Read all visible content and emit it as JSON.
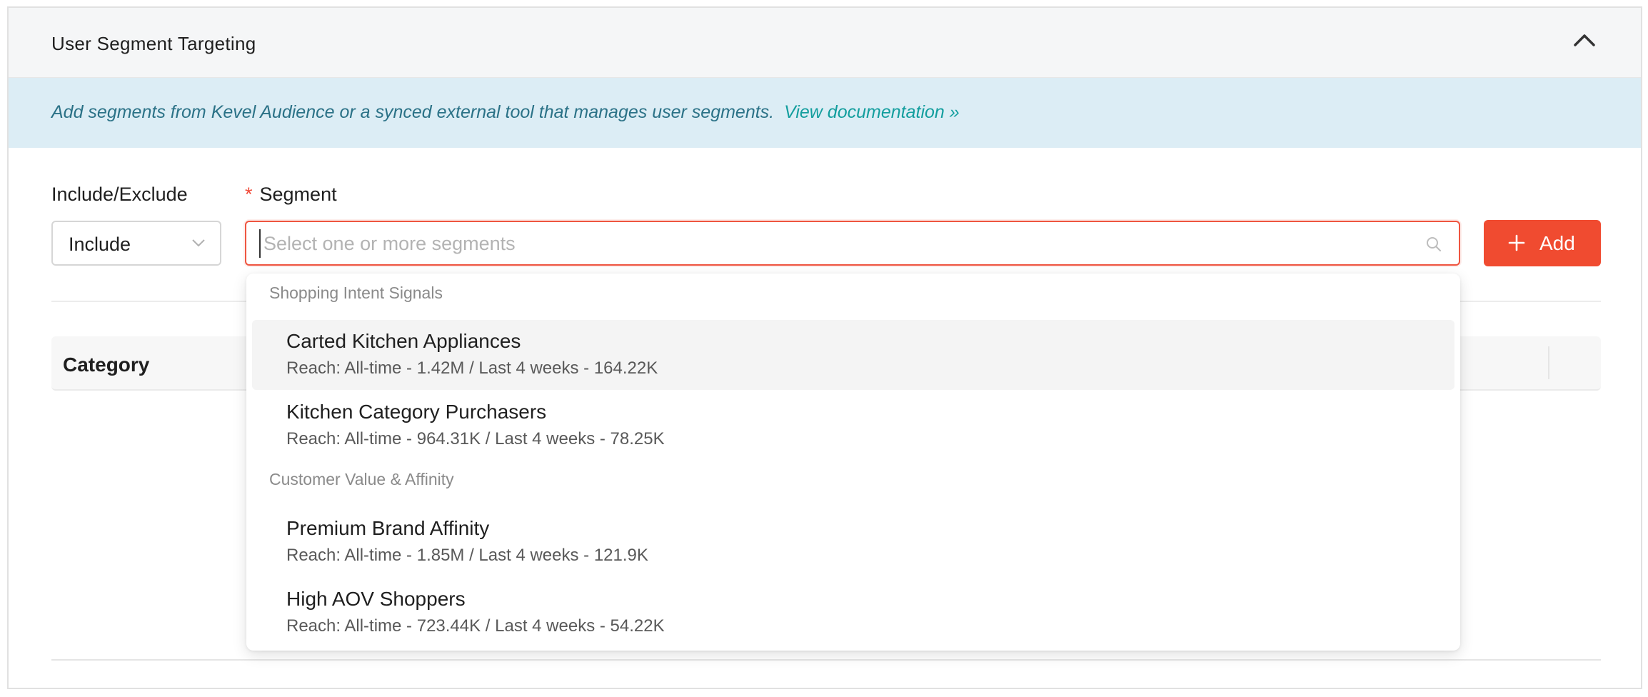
{
  "panel": {
    "title": "User Segment Targeting"
  },
  "banner": {
    "text": "Add segments from Kevel Audience or a synced external tool that manages user segments.",
    "link": "View documentation »"
  },
  "form": {
    "include_exclude_label": "Include/Exclude",
    "include_exclude_value": "Include",
    "segment_label": "Segment",
    "required_mark": "*",
    "segment_placeholder": "Select one or more segments",
    "add_label": "Add"
  },
  "table": {
    "category_header": "Category"
  },
  "dropdown": {
    "groups": [
      {
        "label": "Shopping Intent Signals",
        "options": [
          {
            "title": "Carted Kitchen Appliances",
            "reach": "Reach: All-time - 1.42M / Last 4 weeks - 164.22K",
            "highlighted": true
          },
          {
            "title": "Kitchen Category Purchasers",
            "reach": "Reach: All-time - 964.31K / Last 4 weeks - 78.25K",
            "highlighted": false
          }
        ]
      },
      {
        "label": "Customer Value & Affinity",
        "options": [
          {
            "title": "Premium Brand Affinity",
            "reach": "Reach: All-time - 1.85M / Last 4 weeks - 121.9K",
            "highlighted": false
          },
          {
            "title": "High AOV Shoppers",
            "reach": "Reach: All-time - 723.44K / Last 4 weeks - 54.22K",
            "highlighted": false
          }
        ]
      }
    ]
  },
  "colors": {
    "accent": "#f04b30",
    "banner_bg": "#dcedf5",
    "link": "#139e9e"
  },
  "icons": {
    "collapse": "chevron-up-icon",
    "select": "chevron-down-icon",
    "search": "search-icon",
    "add": "plus-icon"
  }
}
